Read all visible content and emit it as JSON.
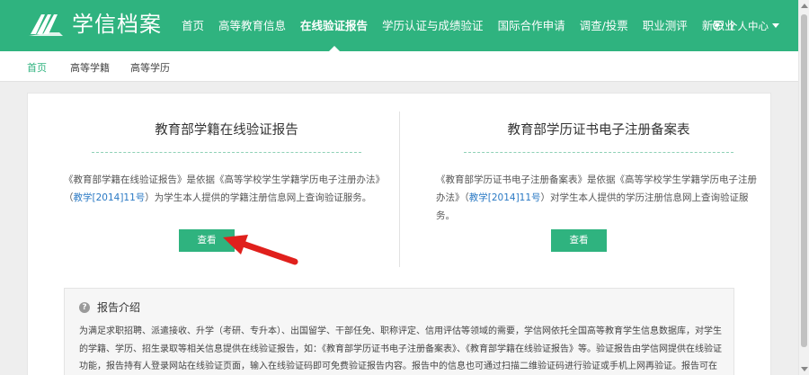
{
  "header": {
    "logo_text": "学信档案",
    "nav": [
      {
        "label": "首页"
      },
      {
        "label": "高等教育信息"
      },
      {
        "label": "在线验证报告",
        "active": true
      },
      {
        "label": "学历认证与成绩验证"
      },
      {
        "label": "国际合作申请"
      },
      {
        "label": "调查/投票"
      },
      {
        "label": "职业测评"
      },
      {
        "label": "新职业"
      }
    ],
    "user_menu": "个人中心"
  },
  "subnav": {
    "items": [
      {
        "label": "首页",
        "active": true
      },
      {
        "label": "高等学籍"
      },
      {
        "label": "高等学历"
      }
    ]
  },
  "cards": {
    "left": {
      "title": "教育部学籍在线验证报告",
      "desc_before": "《教育部学籍在线验证报告》是依据《高等学校学生学籍学历电子注册办法》（",
      "desc_link": "教学[2014]11号",
      "desc_after": "）为学生本人提供的学籍注册信息网上查询验证服务。",
      "button": "查看"
    },
    "right": {
      "title": "教育部学历证书电子注册备案表",
      "desc_before": "《教育部学历证书电子注册备案表》是依据《高等学校学生学籍学历电子注册办法》（",
      "desc_link": "教学[2014]11号",
      "desc_after": "）对学生本人提供的学历注册信息网上查询验证服务。",
      "button": "查看"
    }
  },
  "intro": {
    "title": "报告介绍",
    "text": "为满足求职招聘、派遣接收、升学（考研、专升本）、出国留学、干部任免、职称评定、信用评估等领域的需要，学信网依托全国高等教育学生信息数据库，对学生的学籍、学历、招生录取等相关信息提供在线验证报告，如：《教育部学历证书电子注册备案表》、《教育部学籍在线验证报告》等。验证报告由学信网提供在线验证功能，报告持有人登录网站在线验证页面，输入在线验证码即可免费验证报告内容。报告中的信息也可通过扫描二维验证码进行验证或手机上网再验证。报告可在"
  },
  "colors": {
    "brand_green": "#2fb37f",
    "link_blue": "#2a79c4",
    "annotation_red": "#e0201c"
  }
}
